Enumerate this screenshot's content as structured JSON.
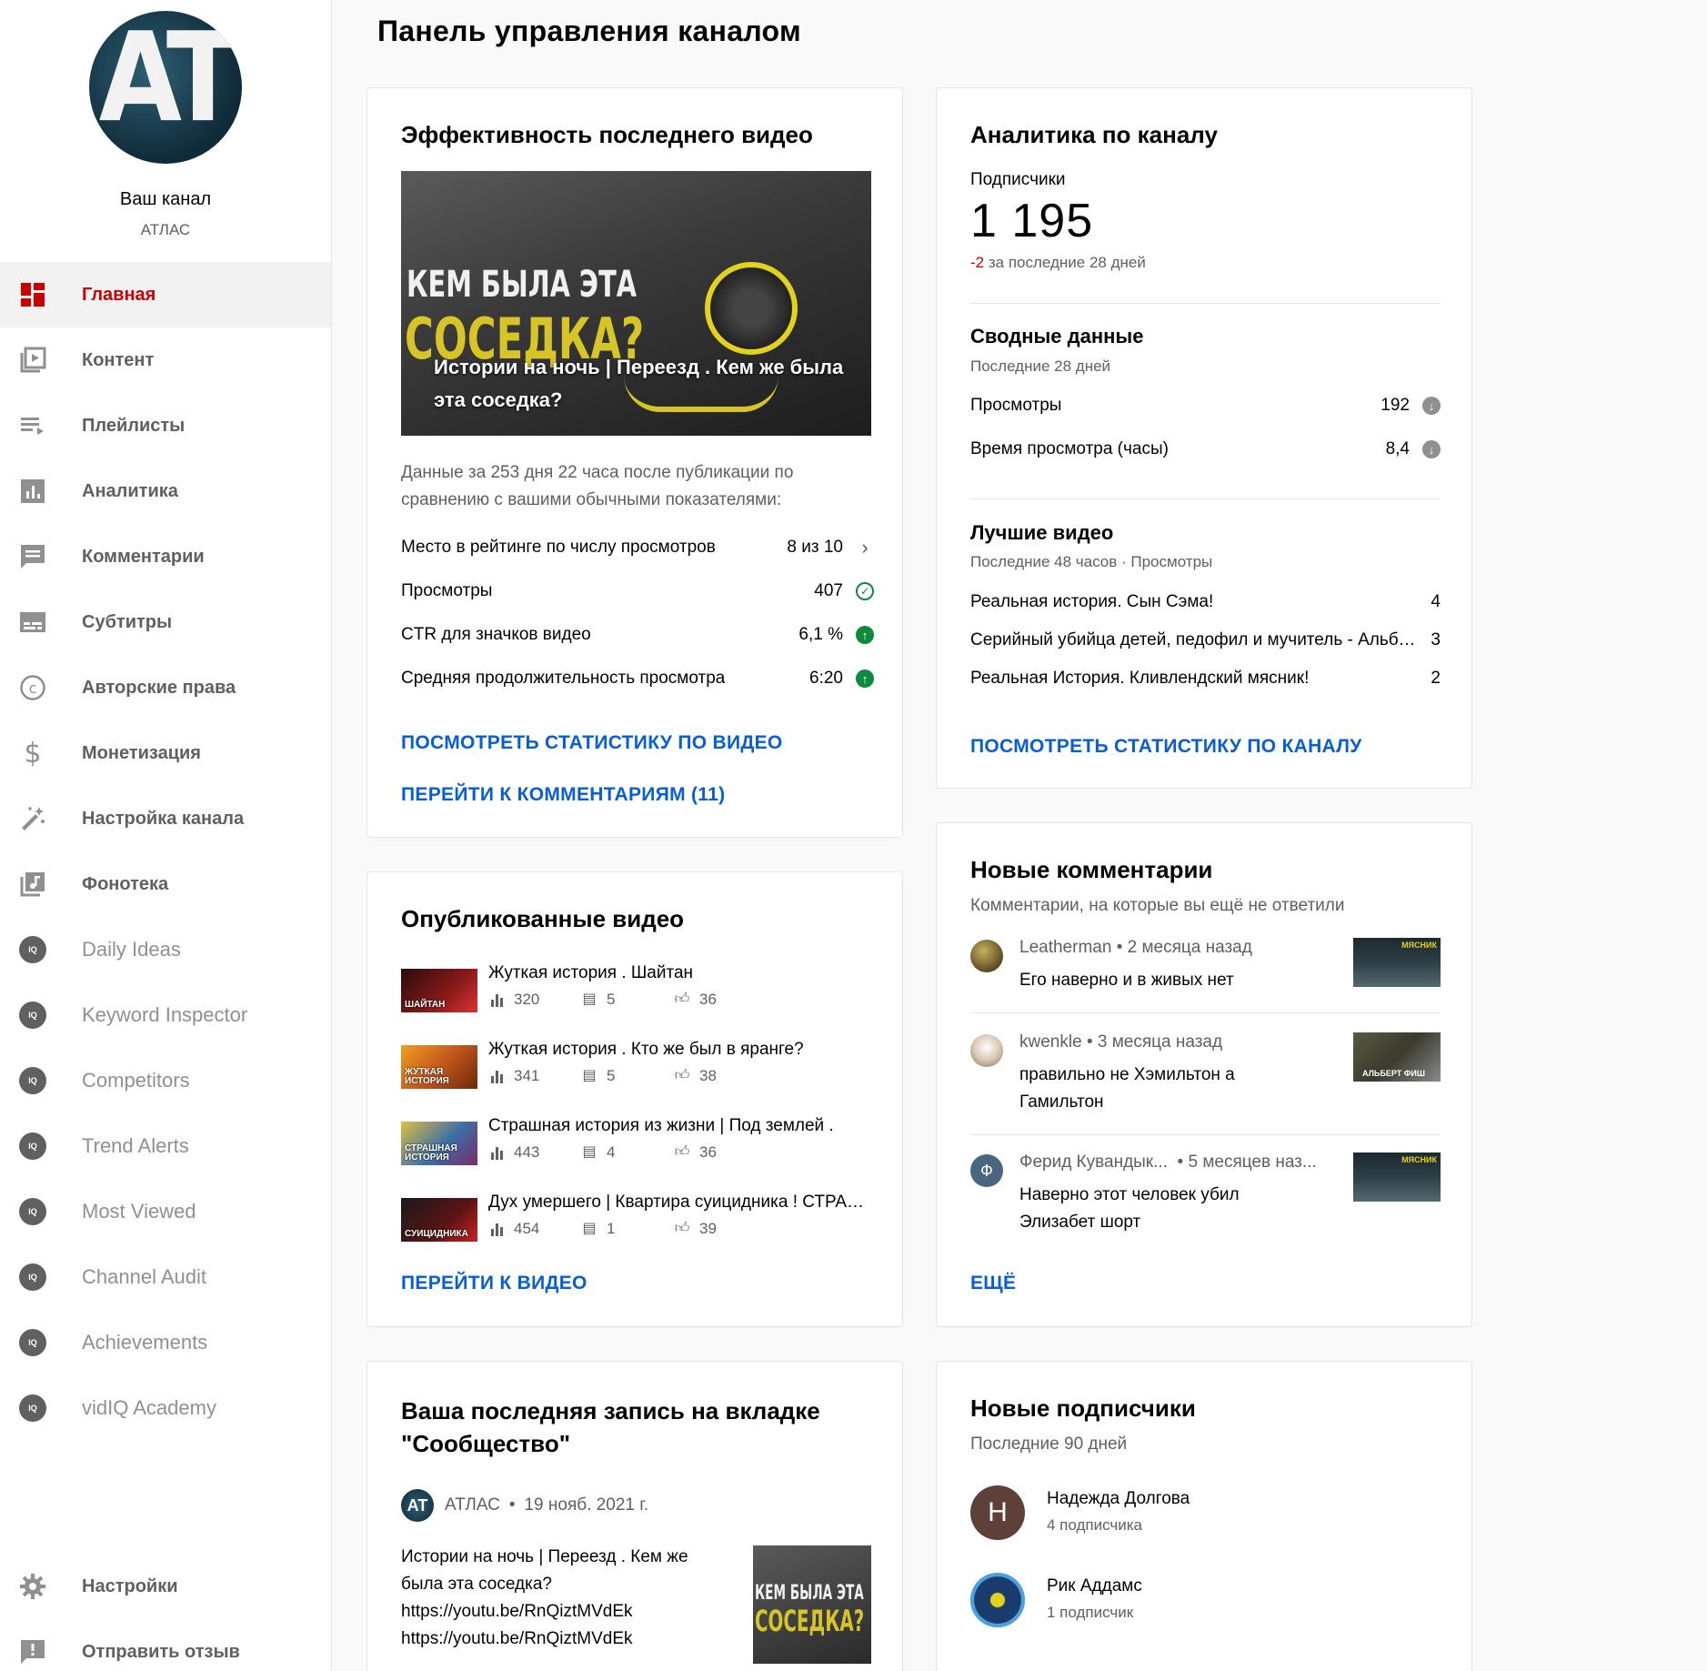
{
  "sidebar": {
    "avatar_text": "AT",
    "channel_label": "Ваш канал",
    "channel_name": "АТЛАС",
    "items": [
      {
        "label": "Главная",
        "icon": "dashboard-icon"
      },
      {
        "label": "Контент",
        "icon": "video-library-icon"
      },
      {
        "label": "Плейлисты",
        "icon": "playlist-icon"
      },
      {
        "label": "Аналитика",
        "icon": "analytics-icon"
      },
      {
        "label": "Комментарии",
        "icon": "comments-icon"
      },
      {
        "label": "Субтитры",
        "icon": "subtitles-icon"
      },
      {
        "label": "Авторские права",
        "icon": "copyright-icon"
      },
      {
        "label": "Монетизация",
        "icon": "dollar-icon"
      },
      {
        "label": "Настройка канала",
        "icon": "magic-wand-icon"
      },
      {
        "label": "Фонотека",
        "icon": "audio-library-icon"
      }
    ],
    "vidiq_items": [
      "Daily Ideas",
      "Keyword Inspector",
      "Competitors",
      "Trend Alerts",
      "Most Viewed",
      "Channel Audit",
      "Achievements",
      "vidIQ Academy"
    ],
    "vidiq_badge": "IQ",
    "bottom_items": [
      {
        "label": "Настройки",
        "icon": "gear-icon"
      },
      {
        "label": "Отправить отзыв",
        "icon": "feedback-icon"
      }
    ]
  },
  "page_title": "Панель управления каналом",
  "latest_video": {
    "title": "Эффективность последнего видео",
    "thumb_line1": "КЕМ БЫЛА ЭТА",
    "thumb_line2": "СОСЕДКА?",
    "video_title": "Истории на ночь | Переезд . Кем же была эта соседка?",
    "description": "Данные за 253 дня 22 часа после публикации по сравнению с вашими обычными показателями:",
    "metrics": [
      {
        "label": "Место в рейтинге по числу просмотров",
        "value": "8 из 10",
        "icon": "chevron-right-icon"
      },
      {
        "label": "Просмотры",
        "value": "407",
        "icon": "check-circle-icon"
      },
      {
        "label": "CTR для значков видео",
        "value": "6,1 %",
        "icon": "arrow-up-circle-icon"
      },
      {
        "label": "Средняя продолжительность просмотра",
        "value": "6:20",
        "icon": "arrow-up-circle-icon"
      }
    ],
    "link_stats": "ПОСМОТРЕТЬ СТАТИСТИКУ ПО ВИДЕО",
    "link_comments": "ПЕРЕЙТИ К КОММЕНТАРИЯМ (11)"
  },
  "analytics": {
    "title": "Аналитика по каналу",
    "subs_label": "Подписчики",
    "subs_value": "1 195",
    "subs_delta": "-2",
    "subs_delta_text": "за последние 28 дней",
    "summary_title": "Сводные данные",
    "summary_period": "Последние 28 дней",
    "summary_rows": [
      {
        "label": "Просмотры",
        "value": "192"
      },
      {
        "label": "Время просмотра (часы)",
        "value": "8,4"
      }
    ],
    "top_title": "Лучшие видео",
    "top_period": "Последние 48 часов · Просмотры",
    "top_rows": [
      {
        "label": "Реальная история. Сын Сэма!",
        "value": "4"
      },
      {
        "label": "Серийный убийца детей, педофил и мучитель - Альберт Фиш",
        "value": "3"
      },
      {
        "label": "Реальная История. Кливлендский мясник!",
        "value": "2"
      }
    ],
    "link": "ПОСМОТРЕТЬ СТАТИСТИКУ ПО КАНАЛУ"
  },
  "published": {
    "title": "Опубликованные видео",
    "videos": [
      {
        "title": "Жуткая история . Шайтан",
        "views": "320",
        "comments": "5",
        "likes": "36",
        "thumb_text": "ШАЙТАН",
        "thumb_color": "#8a1a1a"
      },
      {
        "title": "Жуткая история . Кто же был в яранге?",
        "views": "341",
        "comments": "5",
        "likes": "38",
        "thumb_text": "ЖУТКАЯ ИСТОРИЯ",
        "thumb_color": "#c4571c"
      },
      {
        "title": "Страшная история из жизни | Под землей .",
        "views": "443",
        "comments": "4",
        "likes": "36",
        "thumb_text": "СТРАШНАЯ ИСТОРИЯ",
        "thumb_color": "#3b6fa8"
      },
      {
        "title": "Дух умершего | Квартира суицидника ! СТРАШНАЯ ИСТОРИЯ",
        "views": "454",
        "comments": "1",
        "likes": "39",
        "thumb_text": "СУИЦИДНИКА",
        "thumb_color": "#5a1414"
      }
    ],
    "link": "ПЕРЕЙТИ К ВИДЕО"
  },
  "comments": {
    "title": "Новые комментарии",
    "subtitle": "Комментарии, на которые вы ещё не ответили",
    "items": [
      {
        "author": "Leatherman",
        "time": "2 месяца назад",
        "text": "Его наверно и в живых нет",
        "avatar_color": "#6b5a2a",
        "thumb_text": "МЯСНИК",
        "thumb_color": "#2c3e46"
      },
      {
        "author": "kwenkle",
        "time": "3 месяца назад",
        "text": "правильно не Хэмильтон а Гамильтон",
        "avatar_color": "#d9c9b5",
        "thumb_text": "АЛЬБЕРТ ФИШ",
        "thumb_color": "#3a3a2e"
      },
      {
        "author": "Ферид Кувандык...",
        "time": "5 месяцев наз...",
        "text": "Наверно этот человек убил Элизабет шорт",
        "avatar_color": "#4a6580",
        "avatar_letter": "Ф",
        "thumb_text": "МЯСНИК",
        "thumb_color": "#2c3e46"
      }
    ],
    "link": "ЕЩЁ"
  },
  "community": {
    "title": "Ваша последняя запись на вкладке \"Сообщество\"",
    "author": "АТЛАС",
    "date": "19 нояб. 2021 г.",
    "text_line1": "Истории на ночь | Переезд . Кем же была эта соседка?",
    "link1": "https://youtu.be/RnQiztMVdEk",
    "link2": "https://youtu.be/RnQiztMVdEk",
    "thumb_line1": "КЕМ БЫЛА ЭТА",
    "thumb_line2": "СОСЕДКА?"
  },
  "subscribers": {
    "title": "Новые подписчики",
    "period": "Последние 90 дней",
    "items": [
      {
        "name": "Надежда Долгова",
        "count": "4 подписчика",
        "letter": "Н",
        "color": "#5d4037"
      },
      {
        "name": "Рик Аддамс",
        "count": "1 подписчик",
        "letter": "",
        "color": "#1a3b6e"
      }
    ]
  }
}
